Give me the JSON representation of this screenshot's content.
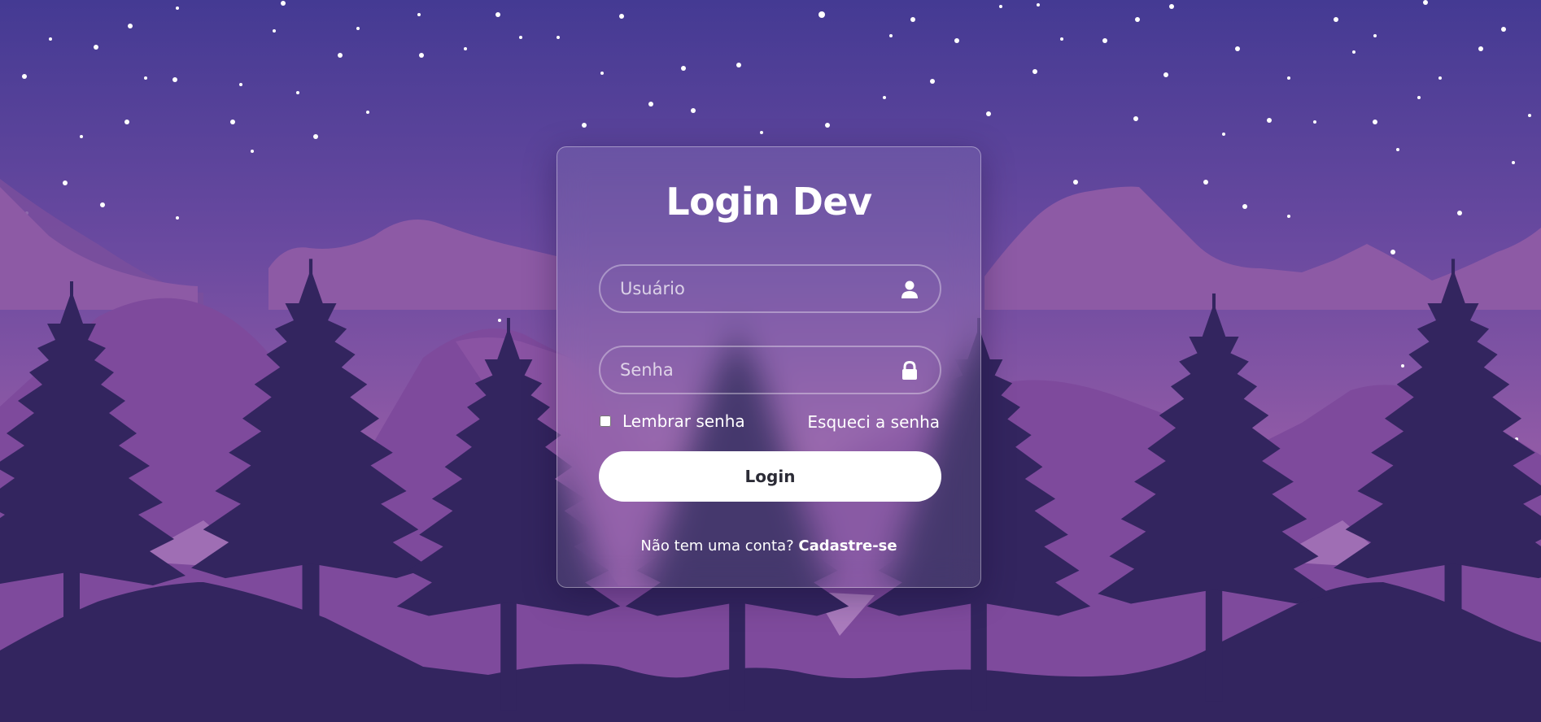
{
  "login": {
    "title": "Login Dev",
    "username": {
      "placeholder": "Usuário",
      "icon": "user-icon"
    },
    "password": {
      "placeholder": "Senha",
      "icon": "lock-icon"
    },
    "remember_label": "Lembrar senha",
    "remember_checked": false,
    "forgot_label": "Esqueci a senha",
    "submit_label": "Login",
    "signup_prompt": "Não tem uma conta? ",
    "signup_link": "Cadastre-se"
  },
  "theme": {
    "sky_top": "#443a93",
    "sky_bottom": "#b471b0",
    "mountain_far": "#8d5aa5",
    "mountain_mid": "#7e4a9c",
    "trees": "#33255f",
    "button_bg": "#ffffff",
    "button_text": "#2b2b36"
  }
}
